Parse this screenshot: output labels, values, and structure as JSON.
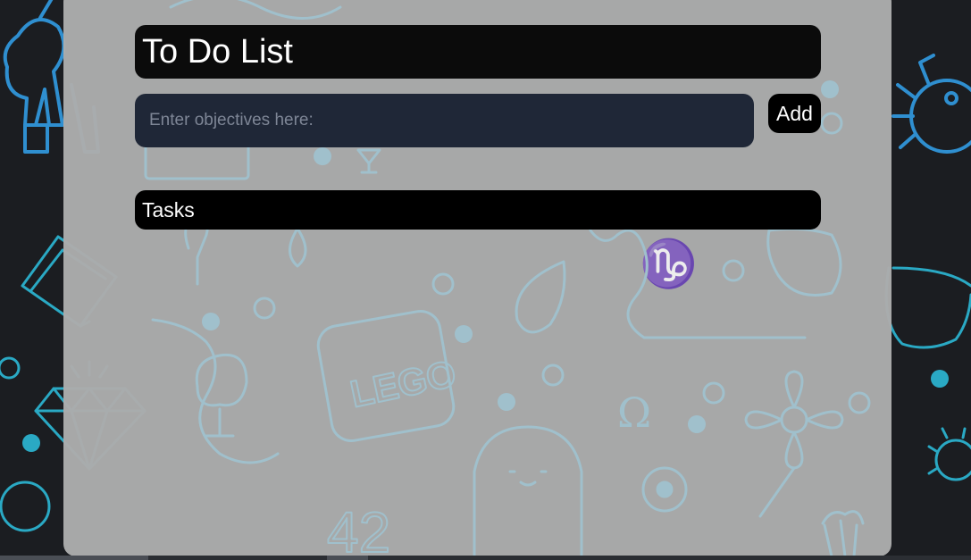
{
  "app": {
    "title": "To Do List"
  },
  "objective": {
    "placeholder": "Enter objectives here:",
    "value": ""
  },
  "add_button": {
    "label": "Add"
  },
  "tasks": {
    "header": "Tasks",
    "items": []
  },
  "colors": {
    "page_background": "#1b1d21",
    "panel_background": "#acacac",
    "title_bar": "#0b0b0b",
    "input_background": "#1f2737",
    "button_background": "#000000",
    "doodle_blue": "#2f8fd0",
    "doodle_teal": "#2aa9c4",
    "panel_doodle": "#9fc4d2"
  },
  "icons": {
    "background": [
      "unicorn-icon",
      "spider-icon",
      "diamond-icon",
      "book-icon",
      "sun-icon",
      "glasses-icon"
    ],
    "panel": [
      "lego-icon",
      "ghost-icon",
      "flower-icon",
      "tree-icon",
      "omega-icon",
      "capricorn-icon",
      "drop-icon",
      "cocktail-icon",
      "popcorn-icon"
    ]
  }
}
